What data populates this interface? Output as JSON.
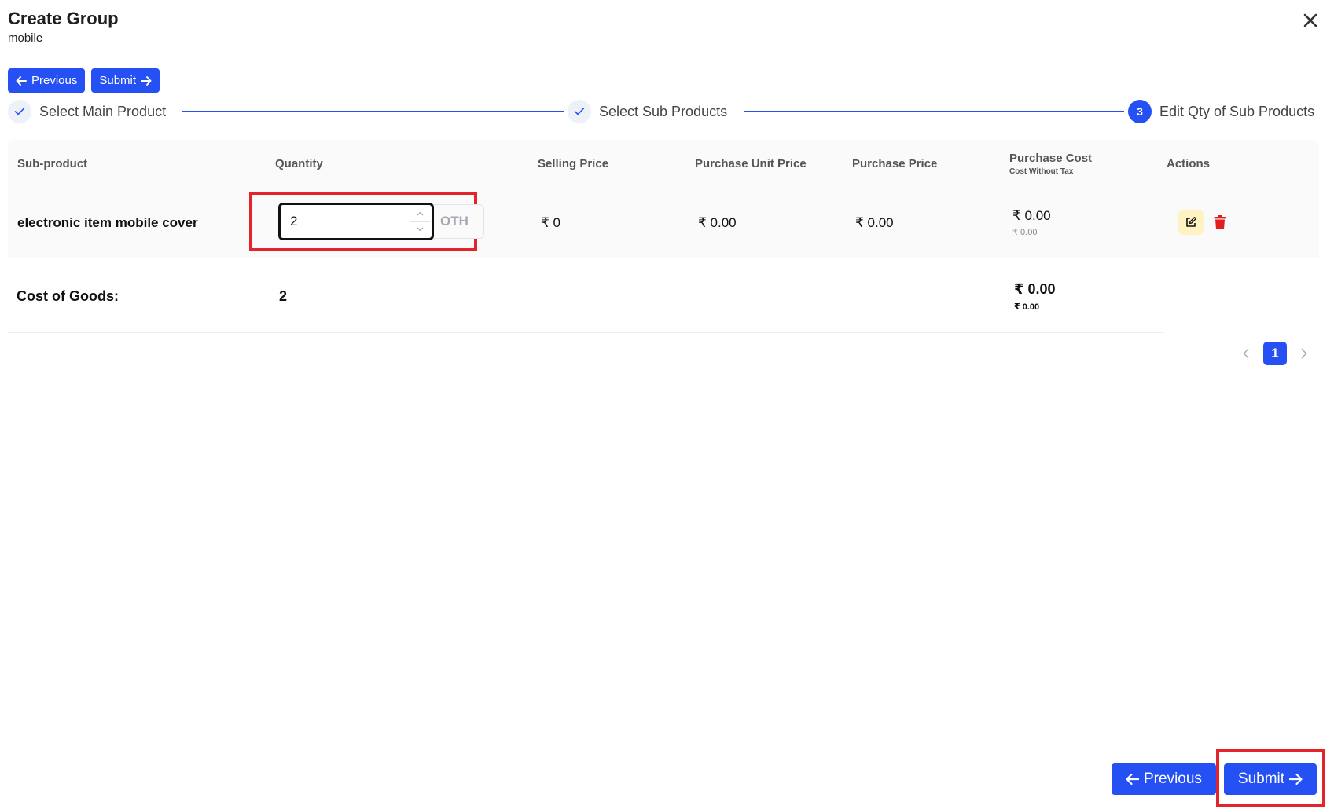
{
  "header": {
    "title": "Create Group",
    "subtitle": "mobile"
  },
  "top_actions": {
    "previous_label": "Previous",
    "submit_label": "Submit"
  },
  "steps": [
    {
      "label": "Select Main Product",
      "status": "complete"
    },
    {
      "label": "Select Sub Products",
      "status": "complete"
    },
    {
      "label": "Edit Qty of Sub Products",
      "status": "active",
      "number": "3"
    }
  ],
  "table": {
    "columns": {
      "sub_product": "Sub-product",
      "quantity": "Quantity",
      "selling_price": "Selling Price",
      "purchase_unit_price": "Purchase Unit Price",
      "purchase_price": "Purchase Price",
      "purchase_cost": "Purchase Cost",
      "purchase_cost_sub": "Cost Without Tax",
      "actions": "Actions"
    },
    "rows": [
      {
        "name": "electronic item mobile cover",
        "quantity": "2",
        "unit": "OTH",
        "selling_price": "₹ 0",
        "purchase_unit_price": "₹ 0.00",
        "purchase_price": "₹ 0.00",
        "purchase_cost": "₹ 0.00",
        "purchase_cost_without_tax": "₹ 0.00"
      }
    ]
  },
  "summary": {
    "label": "Cost of Goods:",
    "quantity": "2",
    "cost": "₹ 0.00",
    "cost_without_tax": "₹ 0.00"
  },
  "pagination": {
    "current_page": "1"
  },
  "bottom_actions": {
    "previous_label": "Previous",
    "submit_label": "Submit"
  },
  "colors": {
    "primary": "#2550f4",
    "highlight": "#e3242b",
    "delete": "#e02020",
    "edit_bg": "#fff3c4"
  }
}
